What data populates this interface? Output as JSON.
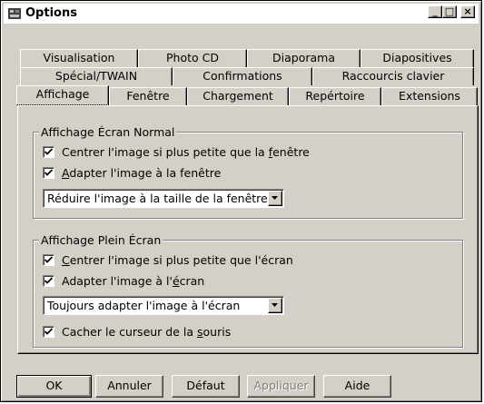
{
  "window": {
    "title": "Options"
  },
  "titlebar_buttons": {
    "minimize": "_",
    "maximize": "□",
    "close": "×"
  },
  "tabs": {
    "row1": [
      "Visualisation",
      "Photo CD",
      "Diaporama",
      "Diapositives"
    ],
    "row2": [
      "Spécial/TWAIN",
      "Confirmations",
      "Raccourcis clavier"
    ],
    "row3": [
      "Affichage",
      "Fenêtre",
      "Chargement",
      "Repértoire",
      "Extensions"
    ],
    "active": "Affichage"
  },
  "normal": {
    "title": "Affichage Écran Normal",
    "center_prefix": "Centrer l'image si plus petite que la ",
    "center_key": "f",
    "center_suffix": "enêtre",
    "center_checked": true,
    "adapt_key": "A",
    "adapt_suffix": "dapter l'image à la fenêtre",
    "adapt_checked": true,
    "combo_value": "Réduire l'image à la taille de la fenêtre"
  },
  "full": {
    "title": "Affichage Plein Écran",
    "center_key": "C",
    "center_suffix": "entrer l'image si plus petite que l'écran",
    "center_checked": true,
    "adapt_prefix": "Adapter l'image à l'",
    "adapt_key": "é",
    "adapt_suffix": "cran",
    "adapt_checked": true,
    "combo_value": "Toujours adapter l'image à l'écran",
    "hide_prefix": "Cacher le curseur de la ",
    "hide_key": "s",
    "hide_suffix": "ouris",
    "hide_checked": true
  },
  "buttons": {
    "ok": "OK",
    "cancel": "Annuler",
    "default": "Défaut",
    "apply": "Appliquer",
    "help": "Aide"
  }
}
